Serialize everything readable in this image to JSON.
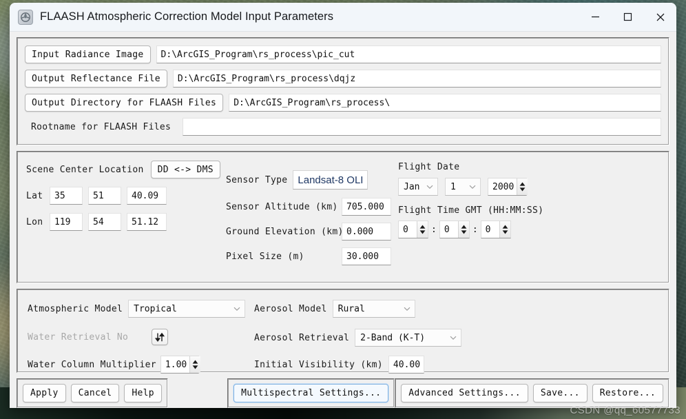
{
  "window": {
    "title": "FLAASH Atmospheric Correction Model Input Parameters",
    "icon": "flaash-app-icon",
    "controls": {
      "minimize": "minimize-icon",
      "maximize": "maximize-icon",
      "close": "close-icon"
    }
  },
  "files": {
    "input_radiance_button": "Input Radiance Image",
    "input_radiance_value": "D:\\ArcGIS_Program\\rs_process\\pic_cut",
    "output_reflectance_button": "Output Reflectance File",
    "output_reflectance_value": "D:\\ArcGIS_Program\\rs_process\\dqjz",
    "output_directory_button": "Output Directory for FLAASH Files",
    "output_directory_value": "D:\\ArcGIS_Program\\rs_process\\",
    "rootname_label": "Rootname for FLAASH Files",
    "rootname_value": ""
  },
  "scene": {
    "center_location_label": "Scene Center Location",
    "dd_dms_button": "DD <-> DMS",
    "lat_label": "Lat",
    "lat_deg": "35",
    "lat_min": "51",
    "lat_sec": "40.09",
    "lon_label": "Lon",
    "lon_deg": "119",
    "lon_min": "54",
    "lon_sec": "51.12"
  },
  "sensor": {
    "type_label": "Sensor Type",
    "type_value": "Landsat-8 OLI",
    "altitude_label": "Sensor Altitude (km)",
    "altitude_value": "705.000",
    "ground_elevation_label": "Ground Elevation (km)",
    "ground_elevation_value": "0.000",
    "pixel_size_label": "Pixel Size (m)",
    "pixel_size_value": "30.000"
  },
  "flight": {
    "date_label": "Flight Date",
    "month": "Jan",
    "day": "1",
    "year": "2000",
    "time_label": "Flight Time GMT (HH:MM:SS)",
    "hours": "0",
    "minutes": "0",
    "seconds": "0"
  },
  "atmosphere": {
    "model_label": "Atmospheric Model",
    "model_value": "Tropical",
    "water_retrieval_label": "Water Retrieval",
    "water_retrieval_value": "No",
    "water_retrieval_toggle": "updown-arrows-icon",
    "water_column_label": "Water Column Multiplier",
    "water_column_value": "1.00",
    "aerosol_model_label": "Aerosol Model",
    "aerosol_model_value": "Rural",
    "aerosol_retrieval_label": "Aerosol Retrieval",
    "aerosol_retrieval_value": "2-Band (K-T)",
    "visibility_label": "Initial Visibility (km)",
    "visibility_value": "40.00"
  },
  "buttons": {
    "apply": "Apply",
    "cancel": "Cancel",
    "help": "Help",
    "multispectral": "Multispectral Settings...",
    "advanced": "Advanced Settings...",
    "save": "Save...",
    "restore": "Restore..."
  },
  "watermark": "CSDN @qq_60577733",
  "colors": {
    "titlebar": "#f2f6fa",
    "panel": "#f0f0f0",
    "field": "#ffffff",
    "selected_text": "#1f3864",
    "focus_outline": "#7fb0e0"
  }
}
